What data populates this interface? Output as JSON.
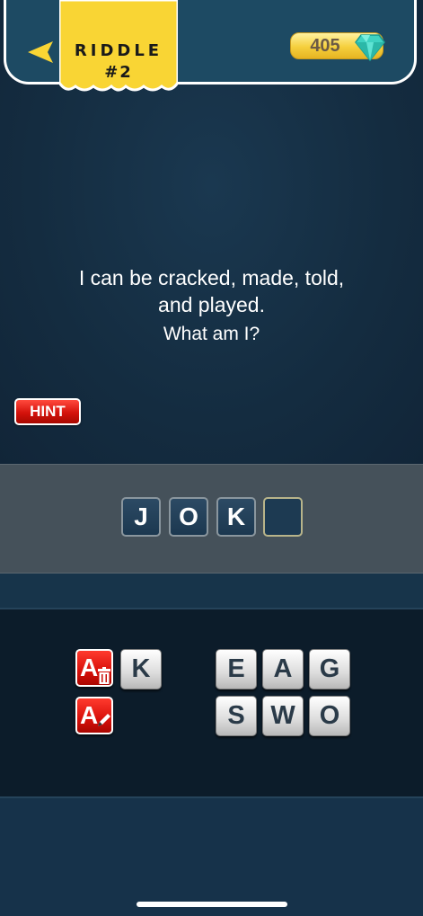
{
  "header": {
    "title_line1": "RIDDLE",
    "title_line2": "#2",
    "gems": "405",
    "back_icon": "back-arrow-icon",
    "gem_icon": "diamond-icon",
    "accent_color": "#f9d534"
  },
  "riddle": {
    "line1": "I can be cracked, made, told,",
    "line2": "and played.",
    "line3": "What am I?"
  },
  "hint_label": "HINT",
  "answer": {
    "slots": [
      "J",
      "O",
      "K",
      ""
    ]
  },
  "tools": {
    "remove_letters_label": "A",
    "remove_letters_icon": "trash-icon",
    "reveal_letter_label": "A",
    "reveal_letter_icon": "pencil-icon"
  },
  "letters": {
    "row1": [
      "K",
      "E",
      "A",
      "G"
    ],
    "row2": [
      "S",
      "W",
      "O"
    ]
  }
}
